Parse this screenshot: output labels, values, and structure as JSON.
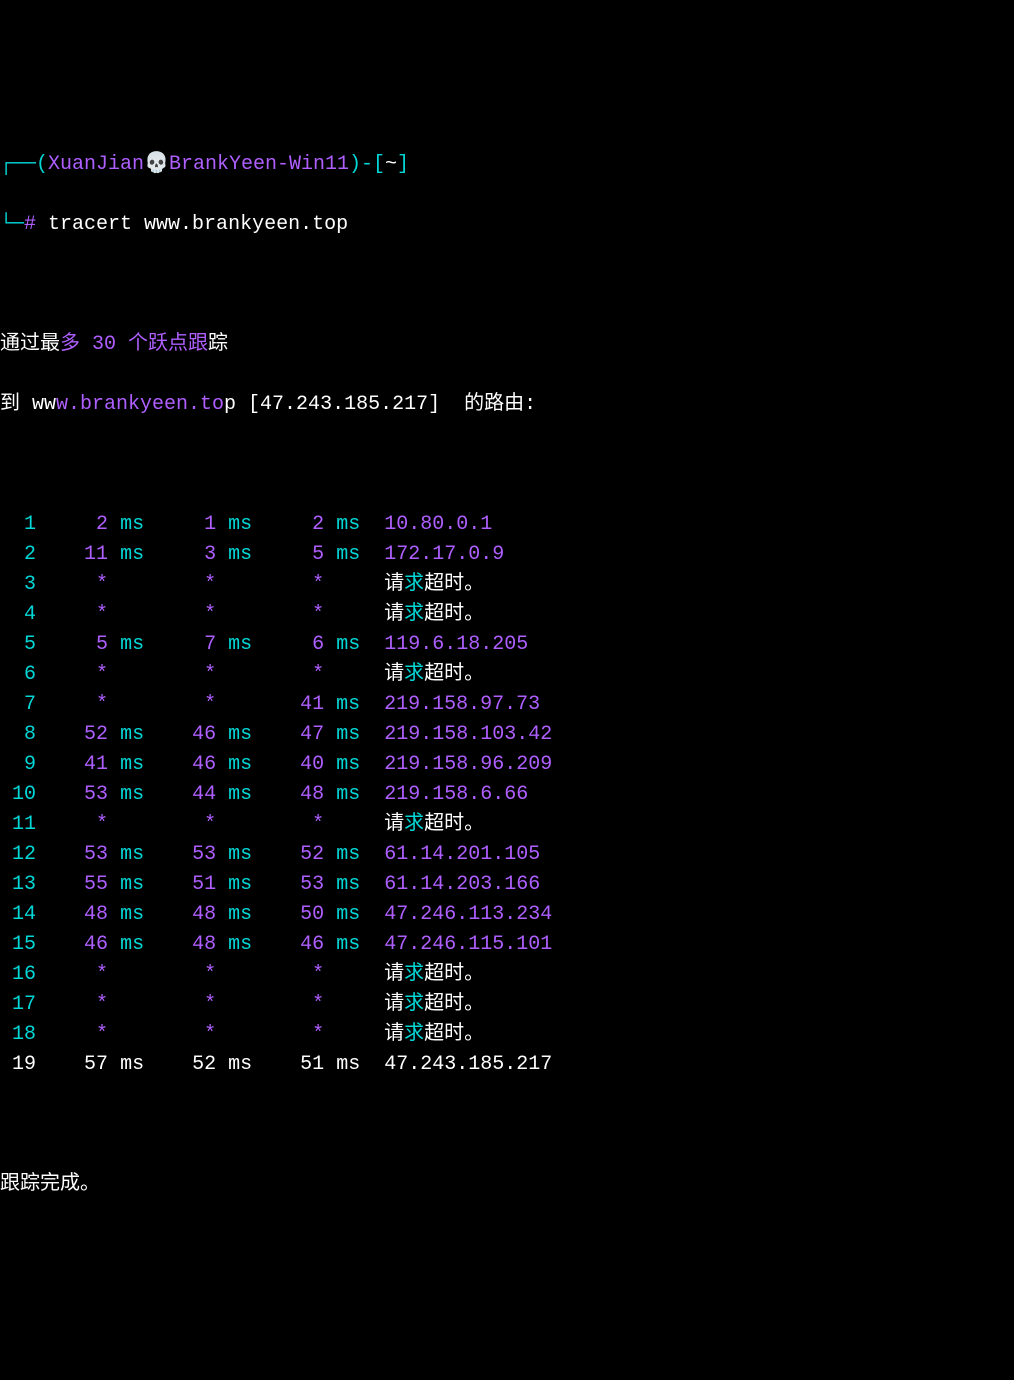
{
  "prompt": {
    "lb": "┌──",
    "op": "(",
    "user": "XuanJian",
    "skull": "💀",
    "host": "BrankYeen-Win11",
    "cp": ")",
    "dash": "-",
    "ob": "[",
    "cwd": "~",
    "cb": "]",
    "line2_lb": "└─",
    "hash": "#",
    "command": " tracert www.brankyeen.top"
  },
  "header": {
    "l1a": "通过最",
    "l1b": "多 30 个跃点跟",
    "l1c": "踪",
    "l2a": "到 ww",
    "l2b": "w.brankyeen.to",
    "l2c": "p [47.243.185.21",
    "l2d": "7]  的路由:"
  },
  "hops": [
    {
      "n": "1",
      "t1": "2",
      "u1": "ms",
      "t2": "1",
      "u2": "ms",
      "t3": "2",
      "u3": "ms",
      "addr": "10.80.0.1",
      "timeout": false
    },
    {
      "n": "2",
      "t1": "11",
      "u1": "ms",
      "t2": "3",
      "u2": "ms",
      "t3": "5",
      "u3": "ms",
      "addr": "172.17.0.9",
      "timeout": false
    },
    {
      "n": "3",
      "t1": "*",
      "u1": "",
      "t2": "*",
      "u2": "",
      "t3": "*",
      "u3": "",
      "addr": "请求超时。",
      "timeout": true
    },
    {
      "n": "4",
      "t1": "*",
      "u1": "",
      "t2": "*",
      "u2": "",
      "t3": "*",
      "u3": "",
      "addr": "请求超时。",
      "timeout": true
    },
    {
      "n": "5",
      "t1": "5",
      "u1": "ms",
      "t2": "7",
      "u2": "ms",
      "t3": "6",
      "u3": "ms",
      "addr": "119.6.18.205",
      "timeout": false
    },
    {
      "n": "6",
      "t1": "*",
      "u1": "",
      "t2": "*",
      "u2": "",
      "t3": "*",
      "u3": "",
      "addr": "请求超时。",
      "timeout": true
    },
    {
      "n": "7",
      "t1": "*",
      "u1": "",
      "t2": "*",
      "u2": "",
      "t3": "41",
      "u3": "ms",
      "addr": "219.158.97.73",
      "timeout": false
    },
    {
      "n": "8",
      "t1": "52",
      "u1": "ms",
      "t2": "46",
      "u2": "ms",
      "t3": "47",
      "u3": "ms",
      "addr": "219.158.103.42",
      "timeout": false
    },
    {
      "n": "9",
      "t1": "41",
      "u1": "ms",
      "t2": "46",
      "u2": "ms",
      "t3": "40",
      "u3": "ms",
      "addr": "219.158.96.209",
      "timeout": false
    },
    {
      "n": "10",
      "t1": "53",
      "u1": "ms",
      "t2": "44",
      "u2": "ms",
      "t3": "48",
      "u3": "ms",
      "addr": "219.158.6.66",
      "timeout": false
    },
    {
      "n": "11",
      "t1": "*",
      "u1": "",
      "t2": "*",
      "u2": "",
      "t3": "*",
      "u3": "",
      "addr": "请求超时。",
      "timeout": true
    },
    {
      "n": "12",
      "t1": "53",
      "u1": "ms",
      "t2": "53",
      "u2": "ms",
      "t3": "52",
      "u3": "ms",
      "addr": "61.14.201.105",
      "timeout": false
    },
    {
      "n": "13",
      "t1": "55",
      "u1": "ms",
      "t2": "51",
      "u2": "ms",
      "t3": "53",
      "u3": "ms",
      "addr": "61.14.203.166",
      "timeout": false
    },
    {
      "n": "14",
      "t1": "48",
      "u1": "ms",
      "t2": "48",
      "u2": "ms",
      "t3": "50",
      "u3": "ms",
      "addr": "47.246.113.234",
      "timeout": false
    },
    {
      "n": "15",
      "t1": "46",
      "u1": "ms",
      "t2": "48",
      "u2": "ms",
      "t3": "46",
      "u3": "ms",
      "addr": "47.246.115.101",
      "timeout": false
    },
    {
      "n": "16",
      "t1": "*",
      "u1": "",
      "t2": "*",
      "u2": "",
      "t3": "*",
      "u3": "",
      "addr": "请求超时。",
      "timeout": true
    },
    {
      "n": "17",
      "t1": "*",
      "u1": "",
      "t2": "*",
      "u2": "",
      "t3": "*",
      "u3": "",
      "addr": "请求超时。",
      "timeout": true
    },
    {
      "n": "18",
      "t1": "*",
      "u1": "",
      "t2": "*",
      "u2": "",
      "t3": "*",
      "u3": "",
      "addr": "请求超时。",
      "timeout": true
    },
    {
      "n": "19",
      "t1": "57",
      "u1": "ms",
      "t2": "52",
      "u2": "ms",
      "t3": "51",
      "u3": "ms",
      "addr": "47.243.185.217",
      "timeout": false,
      "final": true
    }
  ],
  "footer": "跟踪完成。"
}
